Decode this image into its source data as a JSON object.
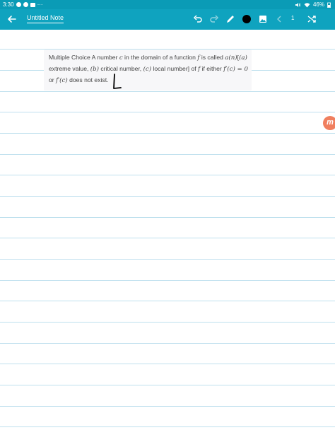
{
  "status_bar": {
    "time": "3:30",
    "overflow": "···",
    "battery": "46%"
  },
  "toolbar": {
    "title": "Untitled Note",
    "page_number": "1",
    "pen_color": "#000000"
  },
  "question": {
    "segments": [
      {
        "t": "Multiple Choice A number "
      },
      {
        "m": "c"
      },
      {
        "t": " in the domain of a function "
      },
      {
        "m": "f"
      },
      {
        "t": " is called "
      },
      {
        "m": "a(n)"
      },
      {
        "t": "["
      },
      {
        "m": "(a)"
      },
      {
        "t": " extreme value, "
      },
      {
        "m": "(b)"
      },
      {
        "t": " critical number, "
      },
      {
        "m": "(c)"
      },
      {
        "t": " local number] of "
      },
      {
        "m": "f"
      },
      {
        "t": " if either "
      },
      {
        "m": "f′(c) = 0"
      },
      {
        "t": " or "
      },
      {
        "m": "f′(c)"
      },
      {
        "t": " does not exist."
      }
    ]
  },
  "fab": {
    "label": "m"
  },
  "colors": {
    "toolbar": "#0fa3bf",
    "status_bar": "#0a9bb6",
    "rule_line": "#bfe0ee",
    "fab": "#f07f5f"
  }
}
